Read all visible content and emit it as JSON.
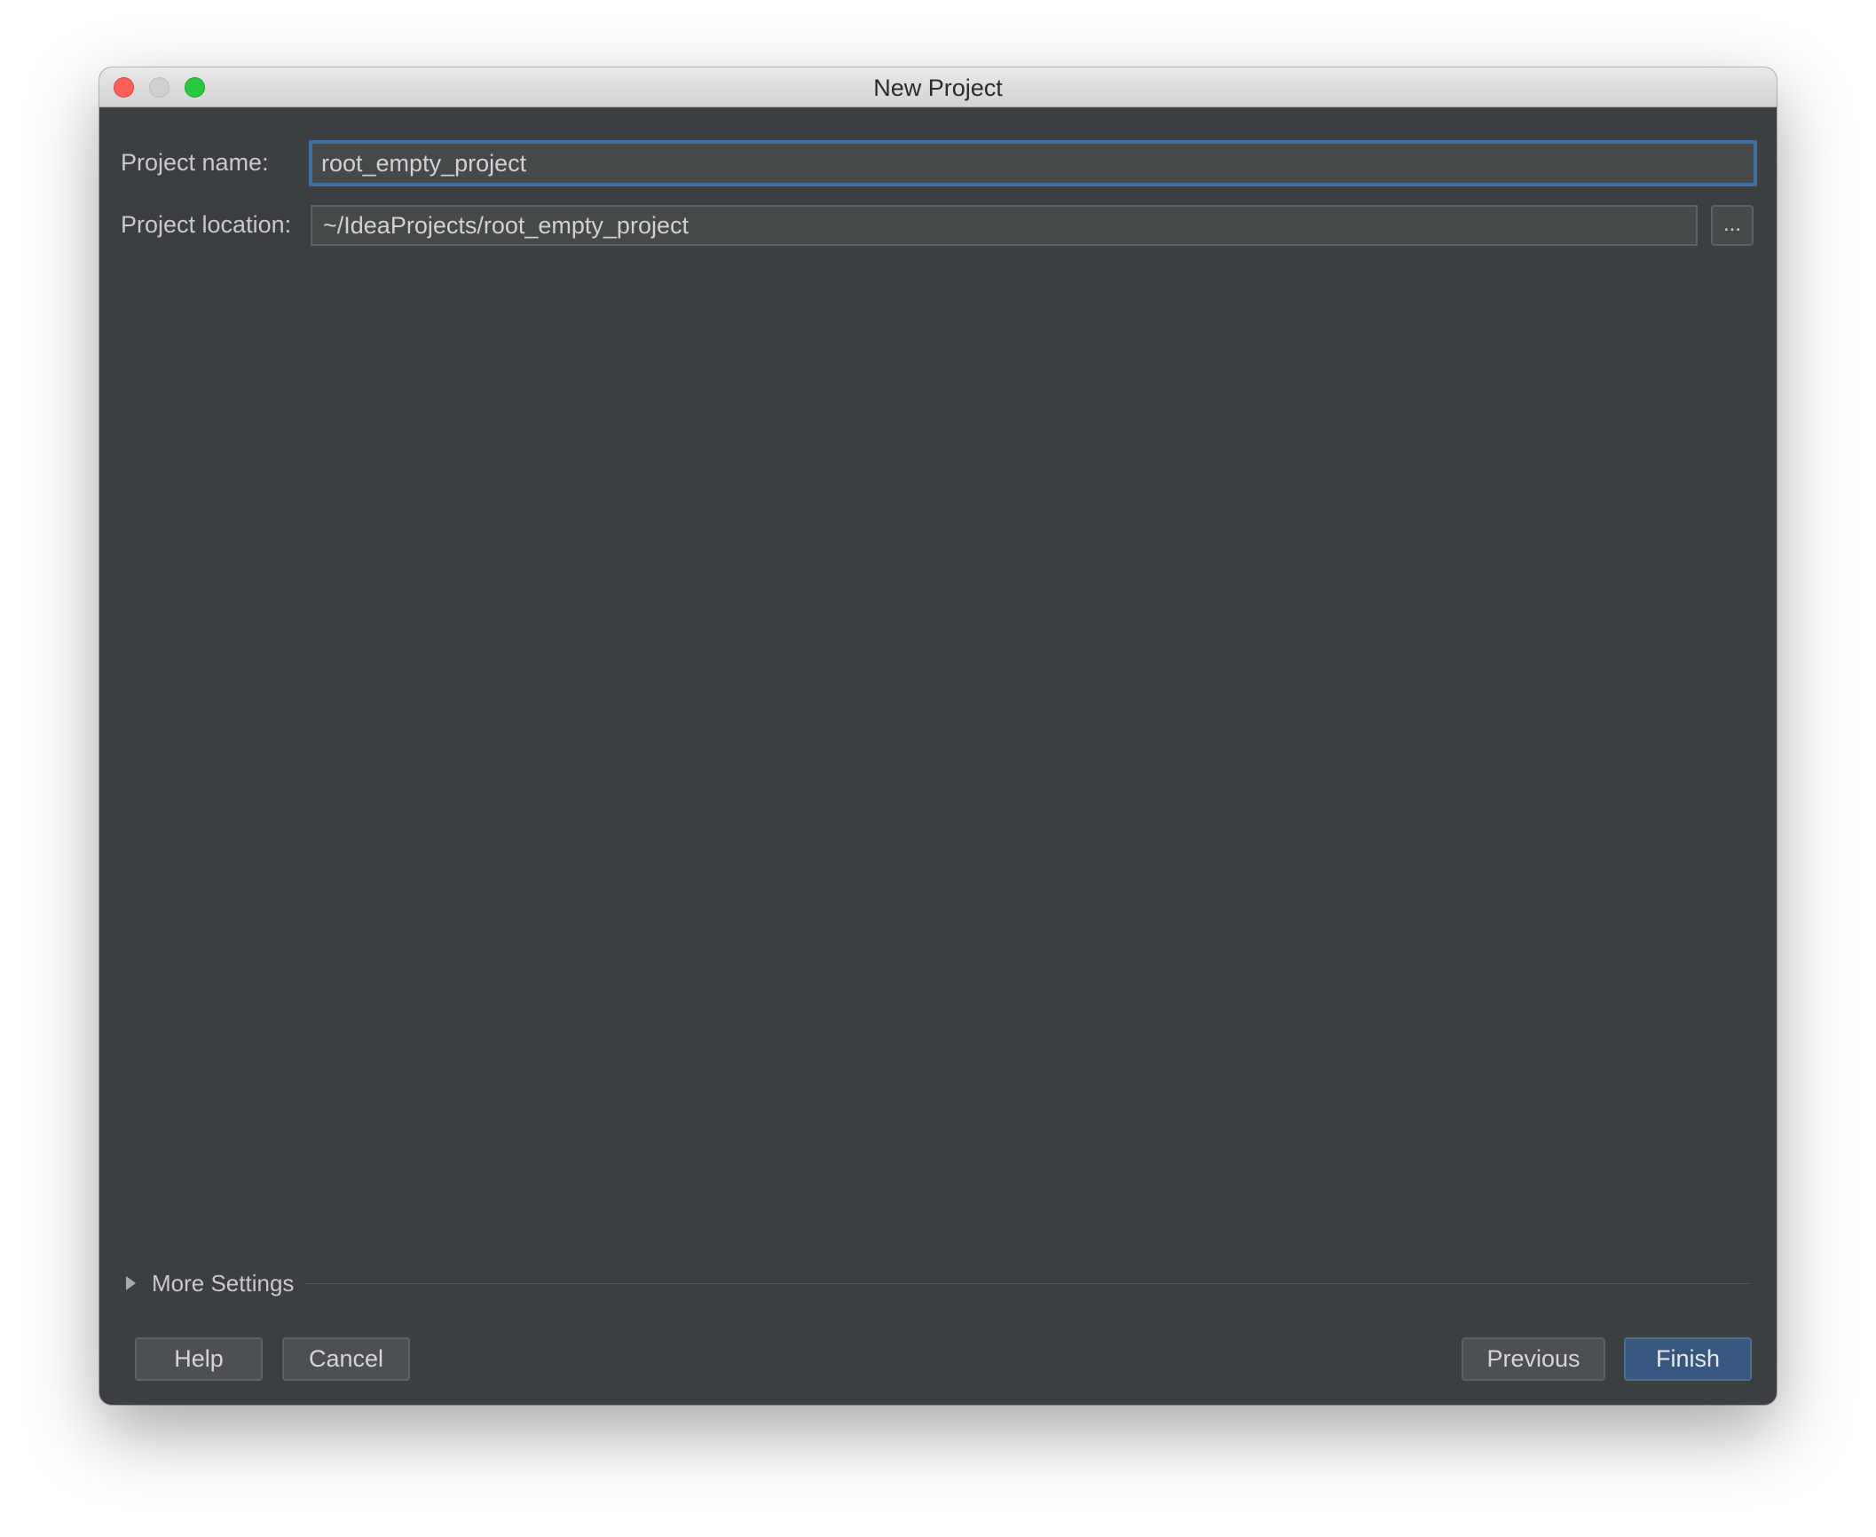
{
  "window": {
    "title": "New Project"
  },
  "form": {
    "project_name_label": "Project name:",
    "project_name_value": "root_empty_project",
    "project_location_label": "Project location:",
    "project_location_value": "~/IdeaProjects/root_empty_project",
    "browse_label": "..."
  },
  "more_settings": {
    "label": "More Settings",
    "expanded": false
  },
  "buttons": {
    "help": "Help",
    "cancel": "Cancel",
    "previous": "Previous",
    "finish": "Finish"
  },
  "colors": {
    "background": "#3b3f42",
    "field": "#45494a",
    "focus_border": "#3d6ea5",
    "primary_button": "#365880"
  }
}
